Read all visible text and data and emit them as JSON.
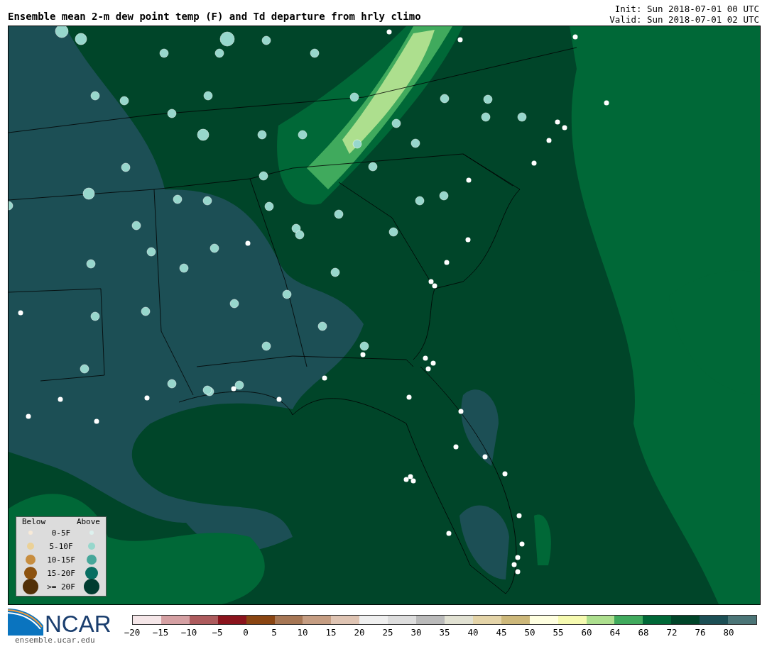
{
  "title": "Ensemble mean 2-m dew point temp (F) and Td departure from hrly climo",
  "init": "Init: Sun 2018-07-01 00 UTC",
  "valid": "Valid: Sun 2018-07-01 02 UTC",
  "legend": {
    "below_label": "Below",
    "above_label": "Above",
    "rows": [
      {
        "label": "0-5F",
        "below": {
          "color": "#f7ead8"
        },
        "above": {
          "color": "#ddf1ee"
        }
      },
      {
        "label": "5-10F",
        "below": {
          "color": "#ebd197"
        },
        "above": {
          "color": "#97d7cc"
        }
      },
      {
        "label": "10-15F",
        "below": {
          "color": "#c78d3f"
        },
        "above": {
          "color": "#46a79a"
        }
      },
      {
        "label": "15-20F",
        "below": {
          "color": "#8c520f"
        },
        "above": {
          "color": "#076d61"
        }
      },
      {
        "label": ">= 20F",
        "below": {
          "color": "#523008"
        },
        "above": {
          "color": "#003c30"
        }
      }
    ]
  },
  "logo": {
    "text": "NCAR",
    "url": "ensemble.ucar.edu"
  },
  "colorbar": {
    "swatches": [
      {
        "color": "#f5e6e8",
        "tick": "−20"
      },
      {
        "color": "#d5a0a3",
        "tick": "−15"
      },
      {
        "color": "#ad5b5d",
        "tick": "−10"
      },
      {
        "color": "#8b141d",
        "tick": "−5"
      },
      {
        "color": "#8a4512",
        "tick": "0"
      },
      {
        "color": "#a67654",
        "tick": "5"
      },
      {
        "color": "#c59d82",
        "tick": "10"
      },
      {
        "color": "#dfc4b3",
        "tick": "15"
      },
      {
        "color": "#efefef",
        "tick": "20"
      },
      {
        "color": "#dddddd",
        "tick": "25"
      },
      {
        "color": "#bababa",
        "tick": "30"
      },
      {
        "color": "#e1e1d2",
        "tick": "35"
      },
      {
        "color": "#e4d4a8",
        "tick": "40"
      },
      {
        "color": "#cdb87a",
        "tick": "45"
      },
      {
        "color": "#ffffe0",
        "tick": "50"
      },
      {
        "color": "#f6fab0",
        "tick": "55"
      },
      {
        "color": "#addf8e",
        "tick": "60"
      },
      {
        "color": "#40aa5d",
        "tick": "64"
      },
      {
        "color": "#006837",
        "tick": "68"
      },
      {
        "color": "#004529",
        "tick": "72"
      },
      {
        "color": "#1c4f55",
        "tick": "76"
      },
      {
        "color": "#4b7577",
        "tick": "80"
      }
    ]
  }
}
